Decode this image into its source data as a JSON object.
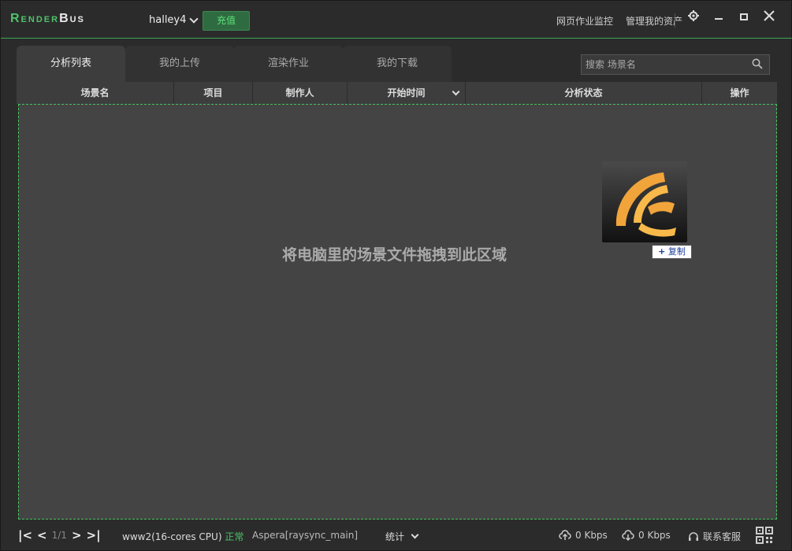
{
  "app": {
    "logo_render": "Render",
    "logo_bus": "Bus"
  },
  "header": {
    "username": "halley4",
    "recharge_label": "充值",
    "web_monitor": "网页作业监控",
    "manage_assets": "管理我的资产"
  },
  "tabs": [
    {
      "label": "分析列表",
      "active": true
    },
    {
      "label": "我的上传",
      "active": false
    },
    {
      "label": "渲染作业",
      "active": false
    },
    {
      "label": "我的下载",
      "active": false
    }
  ],
  "search": {
    "placeholder": "搜索 场景名"
  },
  "table": {
    "columns": [
      "场景名",
      "项目",
      "制作人",
      "开始时间",
      "分析状态",
      "操作"
    ]
  },
  "dropzone": {
    "hint": "将电脑里的场景文件拖拽到此区域",
    "copy_badge": "复制"
  },
  "statusbar": {
    "page": "1/1",
    "server": "www2(16-cores CPU)",
    "server_status": "正常",
    "transfer": "Aspera[raysync_main]",
    "stats": "统计",
    "upload_speed": "0 Kbps",
    "download_speed": "0 Kbps",
    "support": "联系客服"
  },
  "colors": {
    "accent": "#4ec26a",
    "background": "#2b2b2b",
    "dropzone": "#444444"
  }
}
